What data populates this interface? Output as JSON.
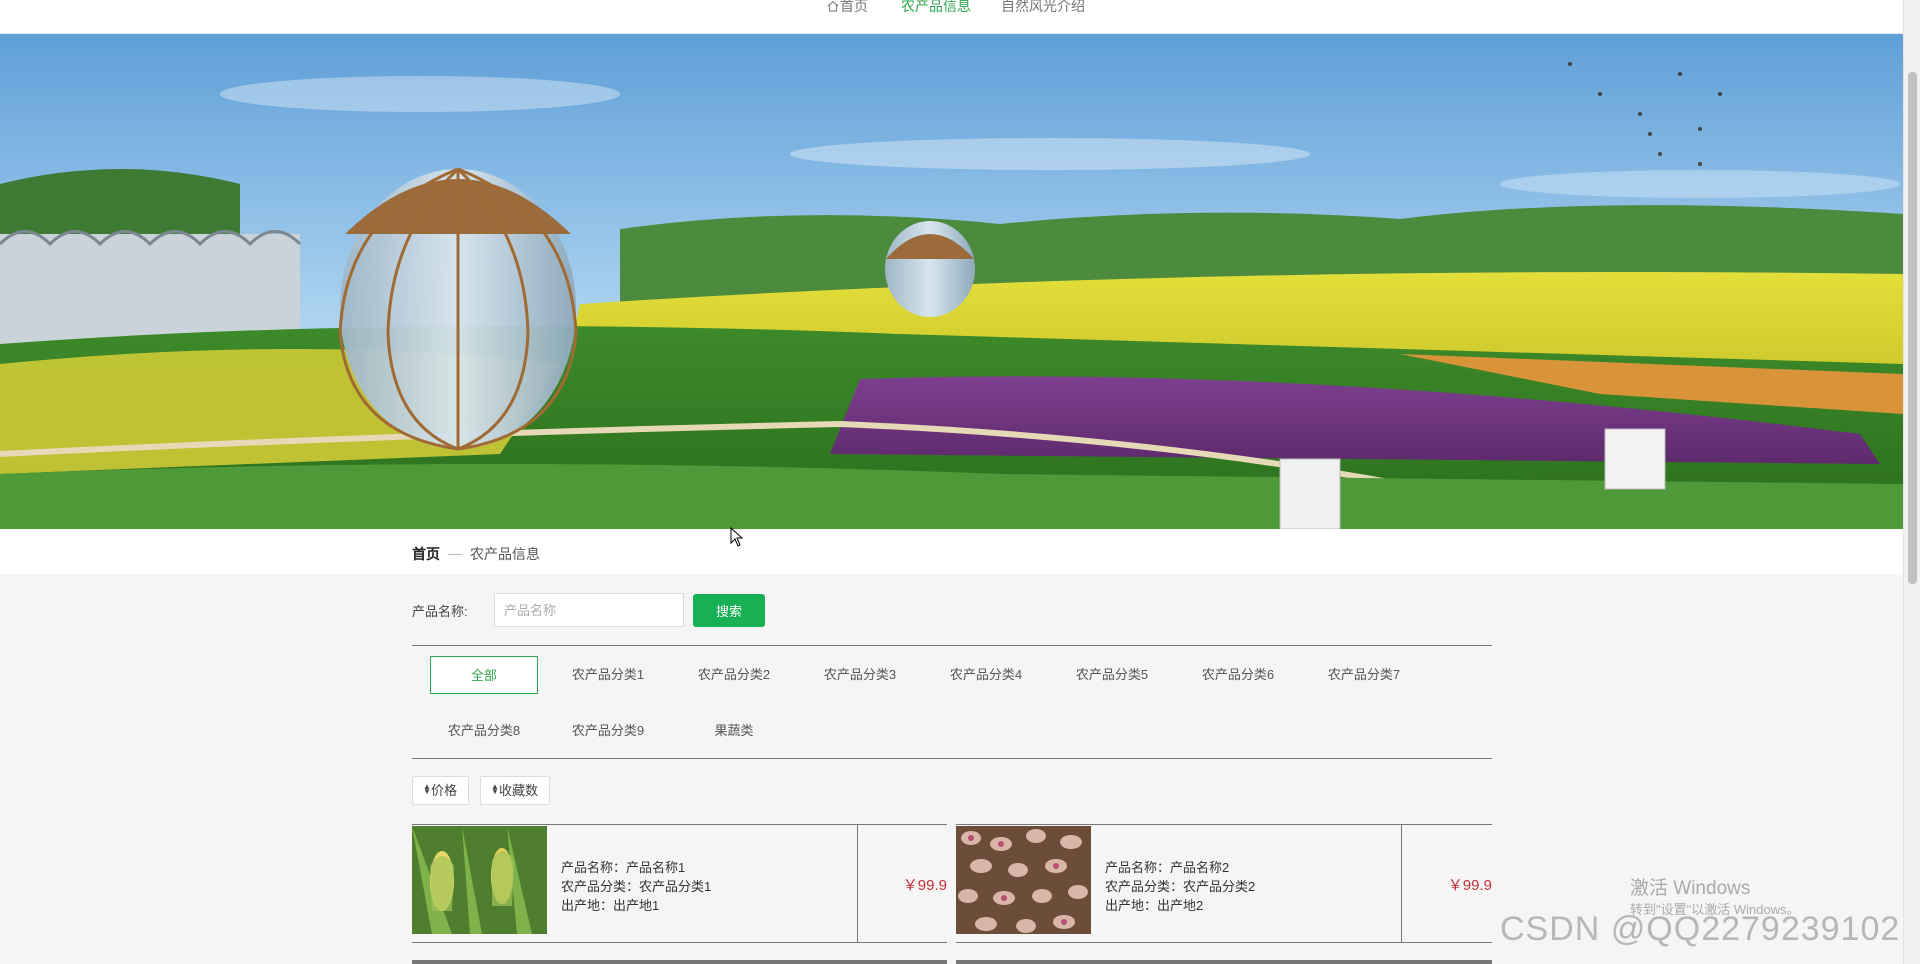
{
  "nav": {
    "home": "首页",
    "products": "农产品信息",
    "nature": "自然风光介绍"
  },
  "breadcrumb": {
    "home": "首页",
    "current": "农产品信息"
  },
  "search": {
    "label": "产品名称:",
    "placeholder": "产品名称",
    "button": "搜索"
  },
  "categories": [
    "全部",
    "农产品分类1",
    "农产品分类2",
    "农产品分类3",
    "农产品分类4",
    "农产品分类5",
    "农产品分类6",
    "农产品分类7",
    "农产品分类8",
    "农产品分类9",
    "果蔬类"
  ],
  "sort": {
    "price": "价格",
    "favorites": "收藏数"
  },
  "products": [
    {
      "name_line": "产品名称：产品名称1",
      "category_line": "农产品分类：农产品分类1",
      "origin_line": "出产地：出产地1",
      "price": "￥99.9"
    },
    {
      "name_line": "产品名称：产品名称2",
      "category_line": "农产品分类：农产品分类2",
      "origin_line": "出产地：出产地2",
      "price": "￥99.9"
    }
  ],
  "watermark": {
    "windows_title": "激活 Windows",
    "windows_sub": "转到\"设置\"以激活 Windows。",
    "csdn": "CSDN @QQ2279239102"
  },
  "colors": {
    "accent": "#2fa84f",
    "button": "#17b055",
    "price": "#c4303a"
  }
}
